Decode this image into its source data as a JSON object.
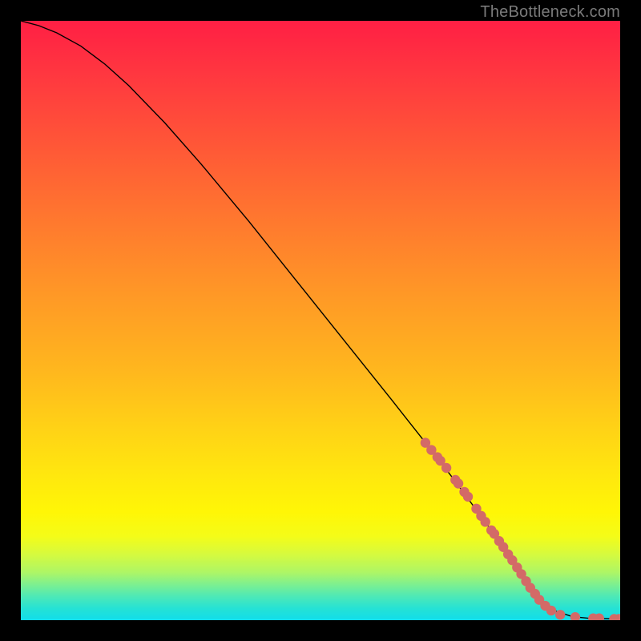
{
  "watermark": "TheBottleneck.com",
  "colors": {
    "dot": "#d36a67",
    "curve": "#000000"
  },
  "chart_data": {
    "type": "line",
    "title": "",
    "xlabel": "",
    "ylabel": "",
    "xlim": [
      0,
      100
    ],
    "ylim": [
      0,
      100
    ],
    "series": [
      {
        "name": "curve",
        "kind": "line",
        "x": [
          0,
          3,
          6,
          10,
          14,
          18,
          24,
          30,
          38,
          46,
          54,
          62,
          68,
          72,
          76,
          78.5,
          80.5,
          82,
          83.5,
          85,
          87,
          89,
          92,
          95,
          100
        ],
        "y": [
          100,
          99.2,
          98.0,
          95.8,
          92.8,
          89.2,
          83.0,
          76.2,
          66.6,
          56.6,
          46.6,
          36.6,
          29.0,
          23.8,
          18.4,
          15.0,
          12.2,
          10.0,
          7.8,
          5.4,
          3.2,
          1.6,
          0.6,
          0.3,
          0.2
        ]
      },
      {
        "name": "points",
        "kind": "scatter",
        "x": [
          67.5,
          68.5,
          69.5,
          70.0,
          71.0,
          72.5,
          73.0,
          74.0,
          74.6,
          76.0,
          76.8,
          77.5,
          78.5,
          79.0,
          79.8,
          80.5,
          81.3,
          82.0,
          82.8,
          83.5,
          84.3,
          85.0,
          85.8,
          86.5,
          87.5,
          88.5,
          90.0,
          92.5,
          95.5,
          96.5,
          99.0,
          99.8
        ],
        "y": [
          29.6,
          28.4,
          27.2,
          26.6,
          25.4,
          23.4,
          22.8,
          21.4,
          20.6,
          18.6,
          17.4,
          16.4,
          15.0,
          14.4,
          13.2,
          12.2,
          11.0,
          10.0,
          8.8,
          7.7,
          6.5,
          5.4,
          4.4,
          3.4,
          2.4,
          1.6,
          0.9,
          0.5,
          0.3,
          0.3,
          0.2,
          0.2
        ]
      }
    ]
  }
}
